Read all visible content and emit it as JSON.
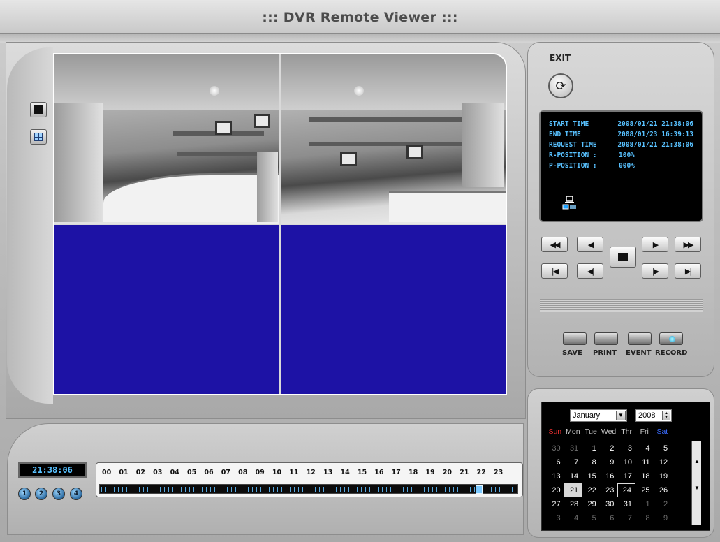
{
  "window": {
    "title": "::: DVR Remote Viewer :::"
  },
  "layout_buttons": [
    {
      "label": "single",
      "icon": "single-view-icon"
    },
    {
      "label": "quad",
      "icon": "quad-view-icon"
    }
  ],
  "exit": {
    "label": "EXIT",
    "icon": "exit-icon"
  },
  "info": {
    "start_time_label": "START TIME",
    "start_time": "2008/01/21 21:38:06",
    "end_time_label": "END TIME",
    "end_time": "2008/01/23 16:39:13",
    "request_time_label": "REQUEST TIME",
    "request_time": "2008/01/21 21:38:06",
    "r_position_label": "R-POSITION :",
    "r_position": "100%",
    "p_position_label": "P-POSITION :",
    "p_position": "000%"
  },
  "playback": {
    "rewind": "◀◀",
    "step_back": "◀",
    "stop": "stop",
    "play": "▶",
    "fast_forward": "▶▶",
    "first": "|◀",
    "frame_back": "◀|",
    "frame_fwd": "|▶",
    "last": "▶|"
  },
  "functions": {
    "save": "SAVE",
    "print": "PRINT",
    "event": "EVENT",
    "record": "RECORD"
  },
  "clock": "21:38:06",
  "channels": [
    "1",
    "2",
    "3",
    "4"
  ],
  "timeline": {
    "hours": [
      "00",
      "01",
      "02",
      "03",
      "04",
      "05",
      "06",
      "07",
      "08",
      "09",
      "10",
      "11",
      "12",
      "13",
      "14",
      "15",
      "16",
      "17",
      "18",
      "19",
      "20",
      "21",
      "22",
      "23"
    ],
    "cursor_fraction": 0.905
  },
  "calendar": {
    "month": "January",
    "year": "2008",
    "weekdays": [
      "Sun",
      "Mon",
      "Tue",
      "Wed",
      "Thr",
      "Fri",
      "Sat"
    ],
    "weekday_colors": {
      "Sun": "#e83030",
      "Sat": "#3a6cff"
    },
    "weeks": [
      [
        "30",
        "31",
        "1",
        "2",
        "3",
        "4",
        "5"
      ],
      [
        "6",
        "7",
        "8",
        "9",
        "10",
        "11",
        "12"
      ],
      [
        "13",
        "14",
        "15",
        "16",
        "17",
        "18",
        "19"
      ],
      [
        "20",
        "21",
        "22",
        "23",
        "24",
        "25",
        "26"
      ],
      [
        "27",
        "28",
        "29",
        "30",
        "31",
        "1",
        "2"
      ],
      [
        "3",
        "4",
        "5",
        "6",
        "7",
        "8",
        "9"
      ]
    ],
    "selected": "21",
    "today": "24"
  },
  "colors": {
    "info_text": "#58c1ff",
    "empty_channel": "#1d12a5"
  }
}
